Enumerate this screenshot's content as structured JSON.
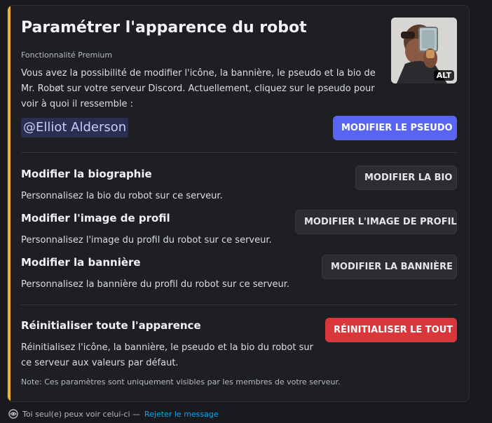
{
  "card": {
    "title": "Paramétrer l'apparence du robot",
    "subtitle": "Fonctionnalité Premium",
    "description": "Vous avez la possibilité de modifier l'icône, la bannière, le pseudo et la bio de Mr. Robøt sur votre serveur Discord. Actuellement, cliquez sur le pseudo pour voir à quoi il ressemble :",
    "thumbnail_alt_badge": "ALT",
    "mention": "@Elliot Alderson",
    "pseudo_button": "MODIFIER LE PSEUDO",
    "accent_color": "#f0b232"
  },
  "sections": {
    "bio": {
      "title": "Modifier la biographie",
      "description": "Personnalisez la bio du robot sur ce serveur.",
      "button": "MODIFIER LA BIO"
    },
    "image": {
      "title": "Modifier l'image de profil",
      "description": "Personnalisez l'image du profil du robot sur ce serveur.",
      "button": "MODIFIER L'IMAGE DE PROFIL"
    },
    "banner": {
      "title": "Modifier la bannière",
      "description": "Personnalisez la bannière du profil du robot sur ce serveur.",
      "button": "MODIFIER LA BANNIÈRE"
    },
    "reset": {
      "title": "Réinitialiser toute l'apparence",
      "description": "Réinitialisez l'icône, la bannière, le pseudo et la bio du robot sur ce serveur aux valeurs par défaut.",
      "button": "RÉINITIALISER LE TOUT"
    }
  },
  "note": "Note: Ces paramètres sont uniquement visibles par les membres de votre serveur.",
  "footer": {
    "icon": "eye-icon",
    "text": "Toi seul(e) peux voir celui-ci —",
    "dismiss_link": "Rejeter le message"
  },
  "colors": {
    "primary": "#5865f2",
    "danger": "#da373c",
    "link": "#00a8fc"
  }
}
